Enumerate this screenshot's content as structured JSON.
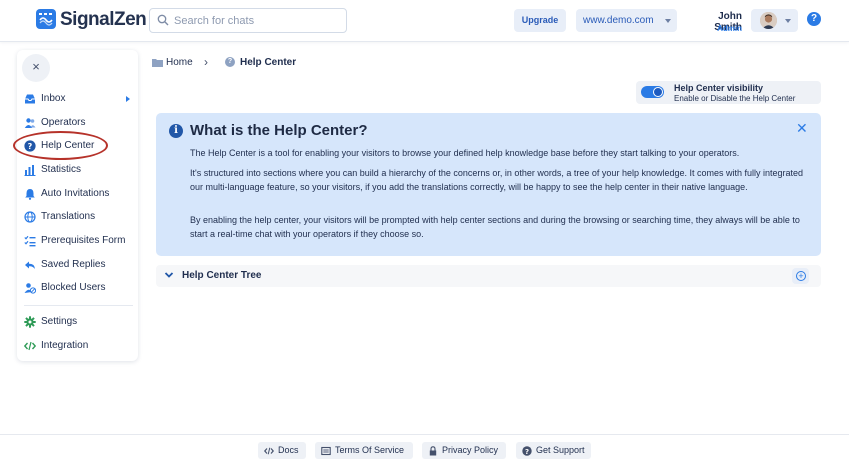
{
  "brand": {
    "name": "SignalZen",
    "accent": "#2b7be5"
  },
  "header": {
    "search_placeholder": "Search for chats",
    "upgrade_label": "Upgrade",
    "site_select_value": "www.demo.com",
    "user_name": "John Smith",
    "user_role": "Admin",
    "help_icon": "?"
  },
  "sidebar": {
    "close_icon": "×",
    "items": [
      {
        "label": "Inbox",
        "icon": "inbox-icon"
      },
      {
        "label": "Operators",
        "icon": "operators-icon"
      },
      {
        "label": "Help Center",
        "icon": "help-center-icon"
      },
      {
        "label": "Statistics",
        "icon": "statistics-icon"
      },
      {
        "label": "Auto Invitations",
        "icon": "bell-icon"
      },
      {
        "label": "Translations",
        "icon": "globe-icon"
      },
      {
        "label": "Prerequisites Form",
        "icon": "checklist-icon"
      },
      {
        "label": "Saved Replies",
        "icon": "replies-icon"
      },
      {
        "label": "Blocked Users",
        "icon": "blocked-user-icon"
      },
      {
        "label": "Settings",
        "icon": "gear-icon"
      },
      {
        "label": "Integration",
        "icon": "code-icon"
      }
    ]
  },
  "breadcrumb": {
    "home": "Home",
    "chevron": "›",
    "current": "Help Center",
    "current_icon": "?"
  },
  "visibility": {
    "title": "Help Center visibility",
    "subtitle": "Enable or Disable the Help Center",
    "enabled": true
  },
  "info": {
    "icon": "i",
    "title": "What is the Help Center?",
    "close_icon": "✕",
    "paragraphs": [
      "The Help Center is a tool for enabling your visitors to browse your defined help knowledge base before they start talking to your operators.",
      "It's structured into sections where you can build a hierarchy of the concerns or, in other words, a tree of your help knowledge. It comes with fully integrated our multi-language feature, so your visitors, if you add the translations correctly, will be happy to see the help center in their native language.",
      "By enabling the help center, your visitors will be prompted with help center sections and during the browsing or searching time, they always will be able to start a real-time chat with your operators if they choose so."
    ]
  },
  "tree": {
    "label": "Help Center Tree",
    "add_icon": "+"
  },
  "footer": {
    "links": [
      {
        "label": "Docs",
        "icon": "code-icon"
      },
      {
        "label": "Terms Of Service",
        "icon": "document-icon"
      },
      {
        "label": "Privacy Policy",
        "icon": "lock-icon"
      },
      {
        "label": "Get Support",
        "icon": "question-icon"
      }
    ]
  }
}
